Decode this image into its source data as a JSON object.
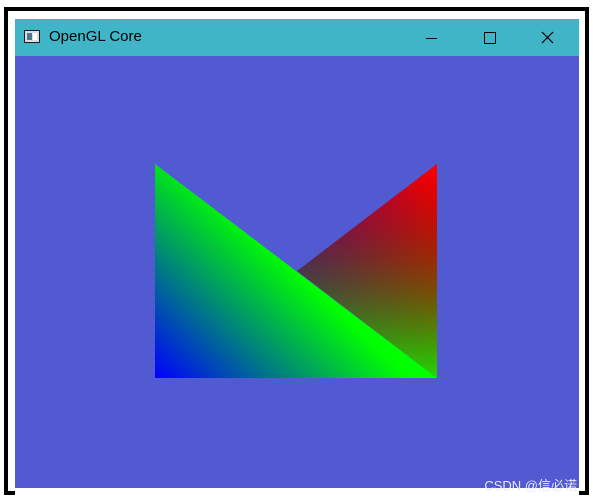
{
  "window": {
    "title": "OpenGL Core",
    "app_icon": "window-app-icon",
    "controls": {
      "minimize_icon": "minimize-icon",
      "maximize_icon": "maximize-icon",
      "close_icon": "close-icon"
    },
    "titlebar_color": "#3fb5c7"
  },
  "viewport": {
    "clear_color": "#525ad2",
    "triangles": [
      {
        "name": "left-triangle",
        "vertex_colors": [
          "#00ff00",
          "#0000ff",
          "#00ff00"
        ]
      },
      {
        "name": "right-triangle",
        "vertex_colors": [
          "#ff0000",
          "#800080",
          "#00ff00"
        ]
      }
    ]
  },
  "watermark": "CSDN @信必诺"
}
